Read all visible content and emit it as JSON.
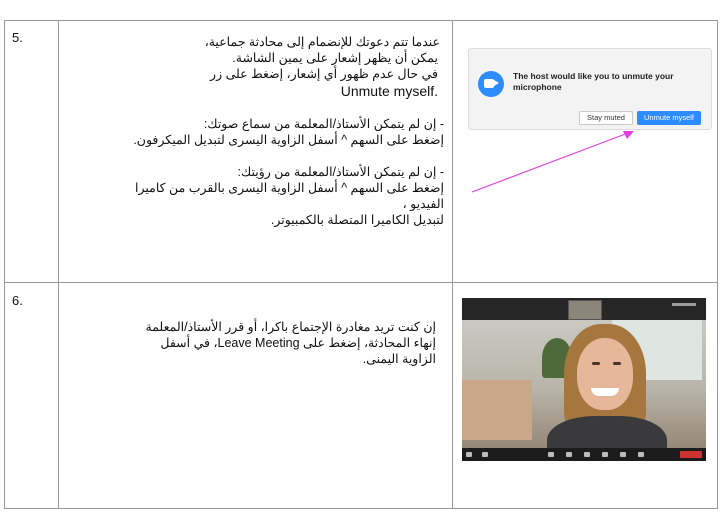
{
  "rows": [
    {
      "number": "5.",
      "instructions": {
        "p1": "عندما تتم دعوتك للإنضمام إلى محادثة جماعية،",
        "p2": "يمكن أن يظهر إشعار على يمين الشاشة.",
        "p3": "في حال عدم ظهور أي إشعار، إضغط على زر",
        "p4": ".Unmute myself",
        "p5": "- إن لم يتمكن الأستاذ/المعلمة من سماع صوتك:",
        "p6": "إضغط على السهم ^ أسفل الزاوية اليسرى لتبديل الميكرفون.",
        "p7": "- إن لم يتمكن الأستاذ/المعلمة من رؤيتك:",
        "p8": "إضغط على السهم ^ أسفل الزاوية اليسرى بالقرب من كاميرا الفيديو ،",
        "p9": "لتبديل الكاميرا المتصلة بالكمبيوتر."
      },
      "dialog": {
        "message": "The host would like you to unmute your microphone",
        "stay_button": "Stay muted",
        "unmute_button": "Unmute myself",
        "logo_icon": "zoom-camera-icon",
        "accent": "#2d8cff"
      },
      "arrow_color": "#e040e0"
    },
    {
      "number": "6.",
      "instructions": {
        "p1": "إن كنت تريد مغادرة الإجتماع باكرا، أو قرر الأستاذ/المعلمة",
        "p2": "إنهاء المحادثة، إضغط على Leave Meeting، في أسفل",
        "p3": "الزاوية اليمنى."
      },
      "image": "zoom-meeting-screenshot"
    }
  ]
}
